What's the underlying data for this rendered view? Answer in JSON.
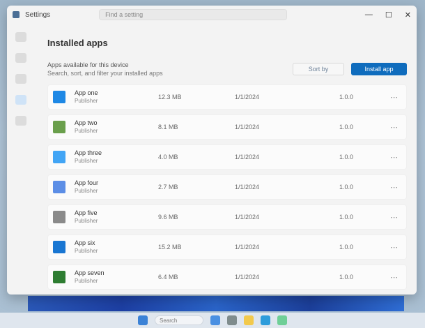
{
  "window": {
    "title": "Settings",
    "search_placeholder": "Find a setting",
    "controls": [
      "—",
      "☐",
      "✕"
    ]
  },
  "page": {
    "title": "Installed apps",
    "header_line1": "Apps available for this device",
    "header_line2": "Search, sort, and filter your installed apps",
    "btn_secondary": "Sort by",
    "btn_primary": "Install app"
  },
  "apps": [
    {
      "name": "App one",
      "publisher": "Publisher",
      "size": "12.3 MB",
      "date": "1/1/2024",
      "version": "1.0.0",
      "color": "#1e88e5"
    },
    {
      "name": "App two",
      "publisher": "Publisher",
      "size": "8.1 MB",
      "date": "1/1/2024",
      "version": "1.0.0",
      "color": "#6a9f4c"
    },
    {
      "name": "App three",
      "publisher": "Publisher",
      "size": "4.0 MB",
      "date": "1/1/2024",
      "version": "1.0.0",
      "color": "#42a5f5"
    },
    {
      "name": "App four",
      "publisher": "Publisher",
      "size": "2.7 MB",
      "date": "1/1/2024",
      "version": "1.0.0",
      "color": "#5c8ee6"
    },
    {
      "name": "App five",
      "publisher": "Publisher",
      "size": "9.6 MB",
      "date": "1/1/2024",
      "version": "1.0.0",
      "color": "#8a8a8a"
    },
    {
      "name": "App six",
      "publisher": "Publisher",
      "size": "15.2 MB",
      "date": "1/1/2024",
      "version": "1.0.0",
      "color": "#1976d2"
    },
    {
      "name": "App seven",
      "publisher": "Publisher",
      "size": "6.4 MB",
      "date": "1/1/2024",
      "version": "1.0.0",
      "color": "#2e7d32"
    }
  ],
  "taskbar": {
    "search_label": "Search",
    "icons": [
      "#4a90e2",
      "#7f8c8d",
      "#f2c94c",
      "#2d9cdb",
      "#6fcf97"
    ]
  }
}
